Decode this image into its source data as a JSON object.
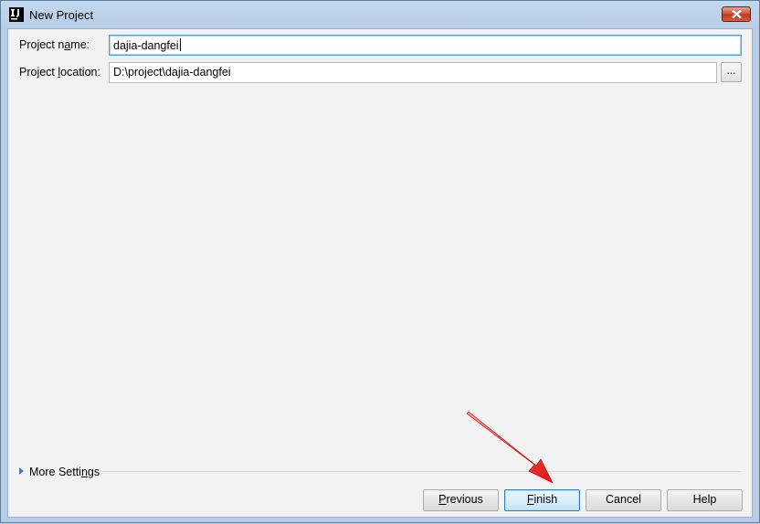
{
  "window": {
    "title": "New Project",
    "app_icon": "intellij-idea-icon",
    "close_icon": "close-icon"
  },
  "form": {
    "project_name": {
      "label_pre": "Project n",
      "label_mnemonic": "a",
      "label_post": "me:",
      "value": "dajia-dangfei"
    },
    "project_location": {
      "label_pre": "Project ",
      "label_mnemonic": "l",
      "label_post": "ocation:",
      "value": "D:\\project\\dajia-dangfei",
      "browse_label": "..."
    }
  },
  "more_settings": {
    "label_pre": "More Setti",
    "label_mnemonic": "n",
    "label_post": "gs",
    "expander_icon": "triangle-right-icon"
  },
  "buttons": {
    "previous": {
      "mnemonic": "P",
      "rest": "revious"
    },
    "finish": {
      "mnemonic": "F",
      "rest": "inish"
    },
    "cancel": {
      "label": "Cancel"
    },
    "help": {
      "label": "Help"
    }
  },
  "annotation": {
    "arrow_color": "#e01010"
  }
}
